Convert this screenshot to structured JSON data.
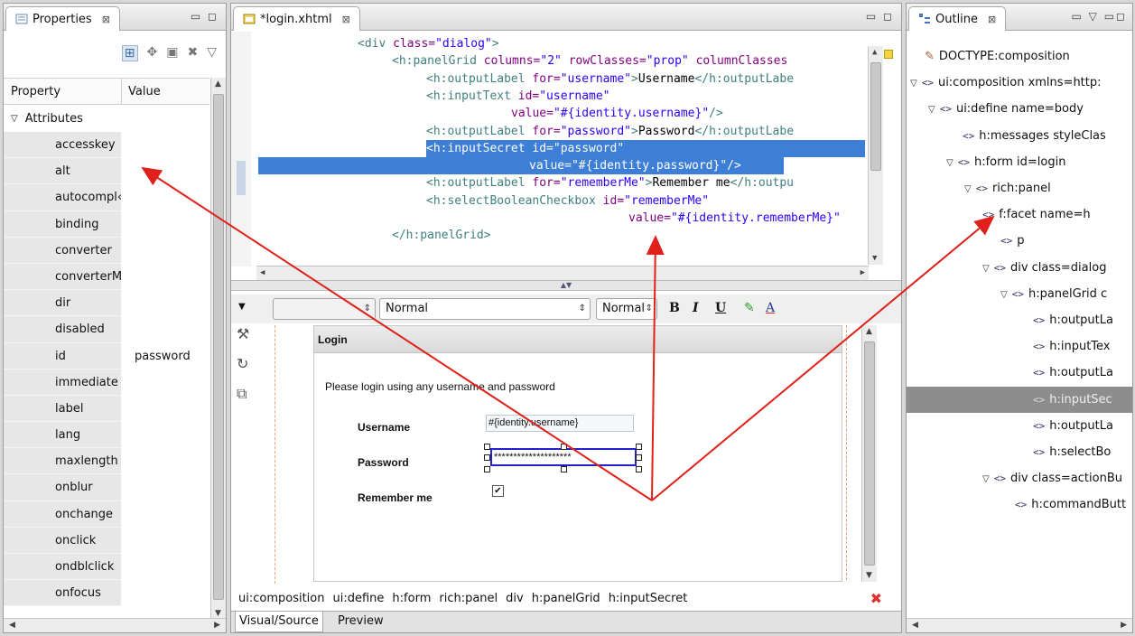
{
  "colors": {
    "accent_selection": "#3d7fd6",
    "arrow": "#e0201a",
    "tree_highlight": "#8d8d8d"
  },
  "properties": {
    "tab_label": "Properties",
    "col_property": "Property",
    "col_value": "Value",
    "group_label": "Attributes",
    "rows": [
      {
        "k": "accesskey",
        "v": ""
      },
      {
        "k": "alt",
        "v": ""
      },
      {
        "k": "autocompl‹",
        "v": ""
      },
      {
        "k": "binding",
        "v": ""
      },
      {
        "k": "converter",
        "v": ""
      },
      {
        "k": "converterM",
        "v": ""
      },
      {
        "k": "dir",
        "v": ""
      },
      {
        "k": "disabled",
        "v": ""
      },
      {
        "k": "id",
        "v": "password"
      },
      {
        "k": "immediate",
        "v": ""
      },
      {
        "k": "label",
        "v": ""
      },
      {
        "k": "lang",
        "v": ""
      },
      {
        "k": "maxlength",
        "v": ""
      },
      {
        "k": "onblur",
        "v": ""
      },
      {
        "k": "onchange",
        "v": ""
      },
      {
        "k": "onclick",
        "v": ""
      },
      {
        "k": "ondblclick",
        "v": ""
      },
      {
        "k": "onfocus",
        "v": ""
      }
    ]
  },
  "editor": {
    "tab_label": "*login.xhtml",
    "code": [
      {
        "parts": [
          [
            "t",
            "<div "
          ],
          [
            "a",
            "class="
          ],
          [
            "s",
            "\"dialog\""
          ],
          [
            "t",
            ">"
          ]
        ]
      },
      {
        "parts": [
          [
            "t",
            "<h:panelGrid "
          ],
          [
            "a",
            "columns="
          ],
          [
            "s",
            "\"2\" "
          ],
          [
            "a",
            "rowClasses="
          ],
          [
            "s",
            "\"prop\" "
          ],
          [
            "a",
            "columnClasses"
          ]
        ]
      },
      {
        "parts": [
          [
            "t",
            "<h:outputLabel "
          ],
          [
            "a",
            "for="
          ],
          [
            "s",
            "\"username\""
          ],
          [
            "t",
            ">"
          ],
          [
            "x",
            "Username"
          ],
          [
            "t",
            "</h:outputLabe"
          ]
        ]
      },
      {
        "parts": [
          [
            "t",
            "<h:inputText "
          ],
          [
            "a",
            "id="
          ],
          [
            "s",
            "\"username\""
          ]
        ]
      },
      {
        "parts": [
          [
            "a",
            "value="
          ],
          [
            "s",
            "\"#{identity.username}\""
          ],
          [
            "t",
            "/>"
          ]
        ]
      },
      {
        "parts": [
          [
            "t",
            "<h:outputLabel "
          ],
          [
            "a",
            "for="
          ],
          [
            "s",
            "\"password\""
          ],
          [
            "t",
            ">"
          ],
          [
            "x",
            "Password"
          ],
          [
            "t",
            "</h:outputLabe"
          ]
        ]
      },
      {
        "parts": [
          [
            "t",
            "<h:inputSecret "
          ],
          [
            "a",
            "id="
          ],
          [
            "s",
            "\"password\""
          ]
        ]
      },
      {
        "parts": [
          [
            "a",
            "value="
          ],
          [
            "s",
            "\"#{identity.password}\""
          ],
          [
            "t",
            "/>"
          ]
        ]
      },
      {
        "parts": [
          [
            "t",
            "<h:outputLabel "
          ],
          [
            "a",
            "for="
          ],
          [
            "s",
            "\"rememberMe\""
          ],
          [
            "t",
            ">"
          ],
          [
            "x",
            "Remember me"
          ],
          [
            "t",
            "</h:outpu"
          ]
        ]
      },
      {
        "parts": [
          [
            "t",
            "<h:selectBooleanCheckbox "
          ],
          [
            "a",
            "id="
          ],
          [
            "s",
            "\"rememberMe\""
          ]
        ]
      },
      {
        "parts": [
          [
            "a",
            "value="
          ],
          [
            "s",
            "\"#{identity.rememberMe}\""
          ]
        ]
      },
      {
        "parts": [
          [
            "t",
            "</h:panelGrid>"
          ]
        ]
      }
    ],
    "format": {
      "style_value": "Normal",
      "size_value": "Normal",
      "bold": "B",
      "italic": "I",
      "underline": "U",
      "font_color": "A"
    },
    "design": {
      "panel_title": "Login",
      "intro": "Please login using any username and password",
      "username_label": "Username",
      "username_value": "#{identity.username}",
      "password_label": "Password",
      "password_value": "********************",
      "remember_label": "Remember me",
      "remember_check": "✔"
    },
    "breadcrumb": [
      "ui:composition",
      "ui:define",
      "h:form",
      "rich:panel",
      "div",
      "h:panelGrid",
      "h:inputSecret"
    ],
    "bottom_tabs": [
      "Visual/Source",
      "Preview"
    ]
  },
  "outline": {
    "tab_label": "Outline",
    "nodes": [
      {
        "label": "DOCTYPE:composition",
        "tri": "",
        "ang": "",
        "doc": true
      },
      {
        "label": "ui:composition xmlns=http:",
        "tri": "▽",
        "ang": "<>"
      },
      {
        "label": "ui:define name=body",
        "tri": "▽",
        "ang": "<>"
      },
      {
        "label": "h:messages styleClas",
        "tri": "",
        "ang": "<>"
      },
      {
        "label": "h:form id=login",
        "tri": "▽",
        "ang": "<>"
      },
      {
        "label": "rich:panel",
        "tri": "▽",
        "ang": "<>"
      },
      {
        "label": "f:facet name=h",
        "tri": "",
        "ang": "<>"
      },
      {
        "label": "p",
        "tri": "",
        "ang": "<>"
      },
      {
        "label": "div class=dialog",
        "tri": "▽",
        "ang": "<>"
      },
      {
        "label": "h:panelGrid c",
        "tri": "▽",
        "ang": "<>"
      },
      {
        "label": "h:outputLa",
        "tri": "",
        "ang": "<>"
      },
      {
        "label": "h:inputTex",
        "tri": "",
        "ang": "<>"
      },
      {
        "label": "h:outputLa",
        "tri": "",
        "ang": "<>"
      },
      {
        "label": "h:inputSec",
        "tri": "",
        "ang": "<>",
        "hl": true
      },
      {
        "label": "h:outputLa",
        "tri": "",
        "ang": "<>"
      },
      {
        "label": "h:selectBo",
        "tri": "",
        "ang": "<>"
      },
      {
        "label": "div class=actionBu",
        "tri": "▽",
        "ang": "<>"
      },
      {
        "label": "h:commandButt",
        "tri": "",
        "ang": "<>"
      }
    ]
  }
}
